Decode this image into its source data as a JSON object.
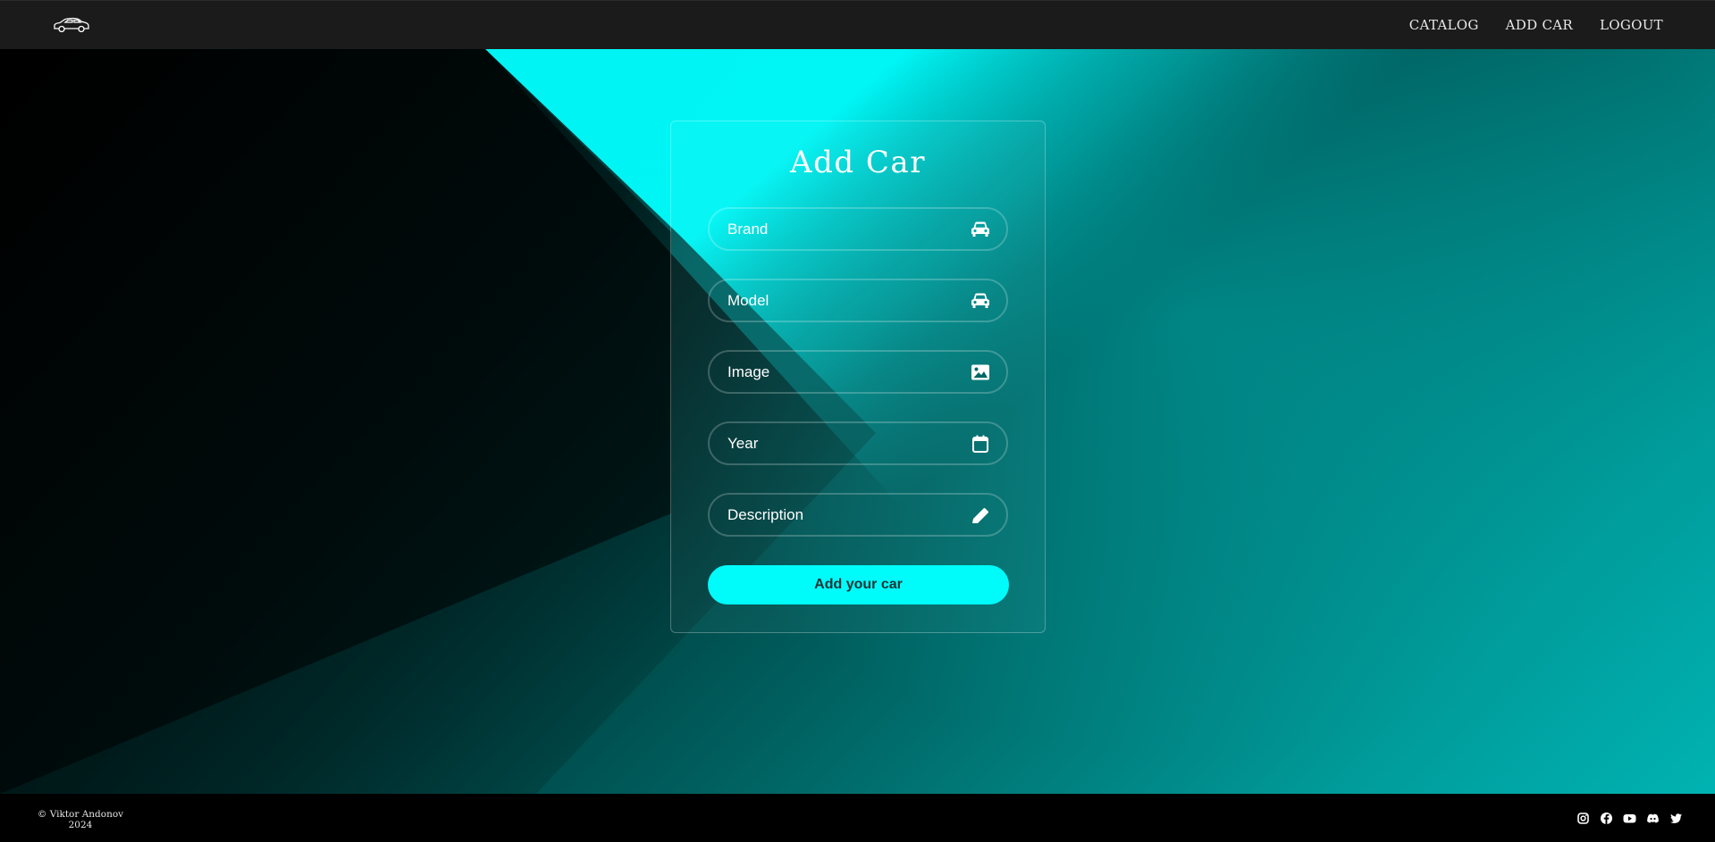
{
  "navbar": {
    "logo_icon": "car-outline-icon",
    "links": [
      {
        "label": "CATALOG"
      },
      {
        "label": "ADD CAR"
      },
      {
        "label": "LOGOUT"
      }
    ]
  },
  "form": {
    "title": "Add Car",
    "fields": [
      {
        "placeholder": "Brand",
        "value": "",
        "icon": "car-icon"
      },
      {
        "placeholder": "Model",
        "value": "",
        "icon": "car-icon"
      },
      {
        "placeholder": "Image",
        "value": "",
        "icon": "image-icon"
      },
      {
        "placeholder": "Year",
        "value": "",
        "icon": "calendar-icon"
      },
      {
        "placeholder": "Description",
        "value": "",
        "icon": "pencil-icon"
      }
    ],
    "submit_label": "Add your car"
  },
  "footer": {
    "copyright_line1": "© Viktor Andonov",
    "copyright_line2": "2024",
    "socials": [
      "instagram-icon",
      "facebook-icon",
      "youtube-icon",
      "discord-icon",
      "twitter-icon"
    ]
  },
  "colors": {
    "accent": "#00fbfb",
    "navbar": "#1b1b1b",
    "footer": "#000000"
  }
}
